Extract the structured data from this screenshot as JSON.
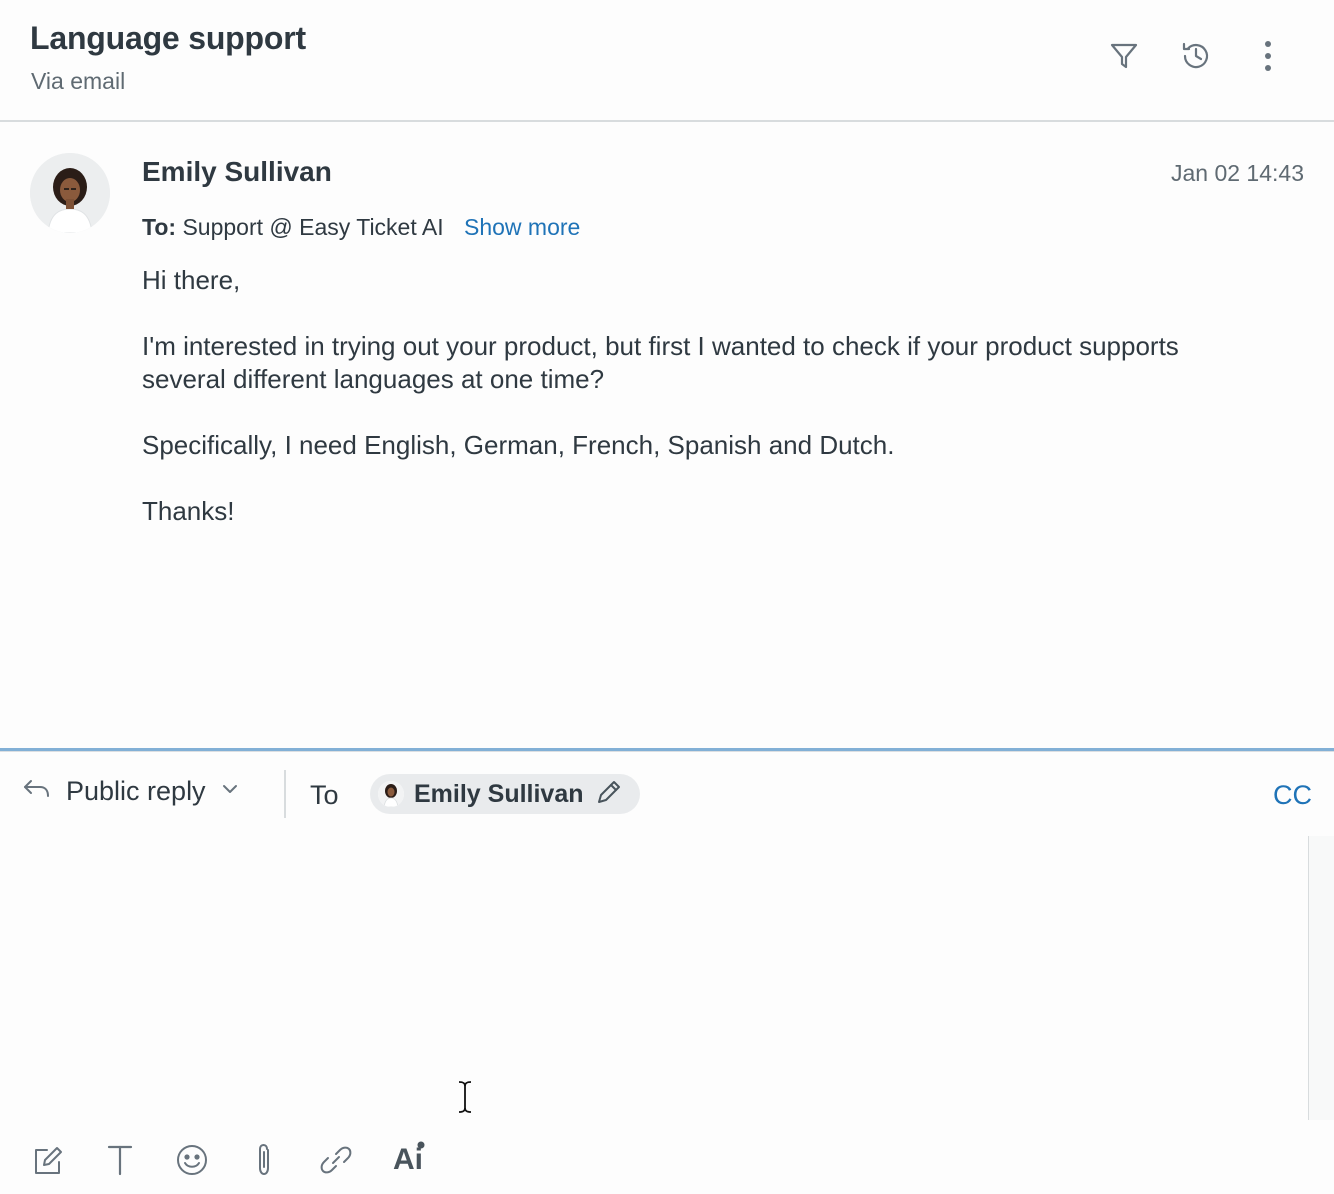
{
  "header": {
    "title": "Language support",
    "subtitle": "Via email",
    "icons": [
      "filter-icon",
      "history-icon",
      "more-vertical-icon"
    ]
  },
  "message": {
    "sender": "Emily Sullivan",
    "timestamp": "Jan 02 14:43",
    "to_label": "To:",
    "to_value": "Support @ Easy Ticket AI",
    "show_more": "Show more",
    "body": [
      "Hi there,",
      "I'm interested in trying out your product, but first I wanted to check if your product supports several different languages at one time?",
      "Specifically, I need English, German, French, Spanish and Dutch.",
      "Thanks!"
    ]
  },
  "composer": {
    "reply_type": "Public reply",
    "to_label": "To",
    "recipient": "Emily Sullivan",
    "cc_label": "CC",
    "toolbar": {
      "icons": [
        "compose-icon",
        "text-format-icon",
        "emoji-icon",
        "attachment-icon",
        "link-icon",
        "ai-icon"
      ],
      "ai_label": "Ai"
    }
  },
  "colors": {
    "accent": "#1f73b7",
    "text": "#2f3941",
    "muted": "#5f6a72"
  }
}
